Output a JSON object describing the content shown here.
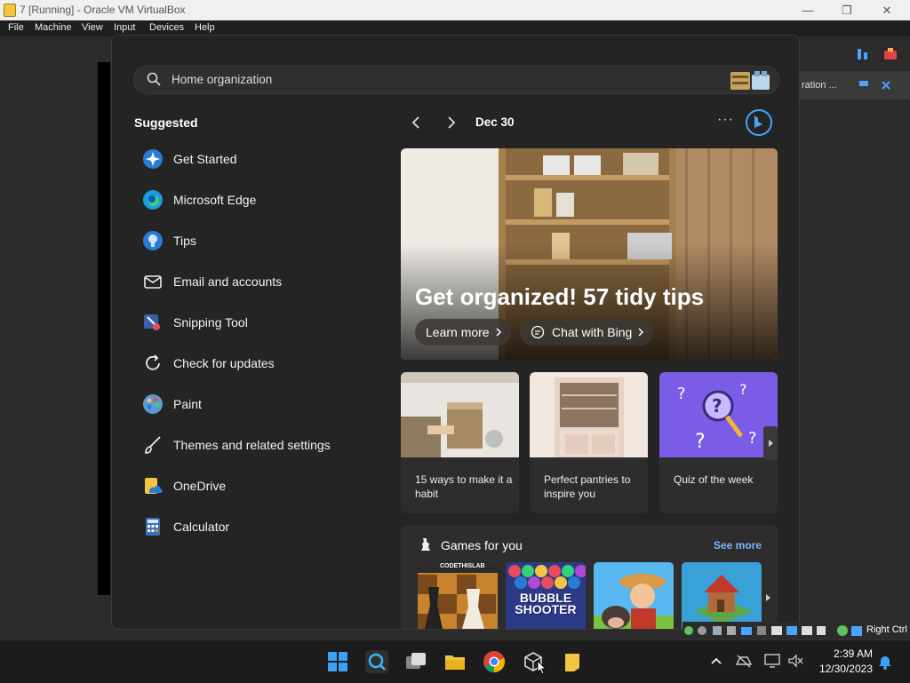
{
  "window": {
    "title": "7 [Running] - Oracle VM VirtualBox",
    "minimize": "—",
    "maximize": "❐",
    "close": "✕"
  },
  "menubar": {
    "items": [
      "File",
      "Machine",
      "View",
      "Input",
      "Devices",
      "Help"
    ]
  },
  "background_window": {
    "partial_text": "ration ..."
  },
  "start_menu": {
    "search": {
      "value": "Home organization"
    },
    "suggested": {
      "heading": "Suggested",
      "items": [
        {
          "label": "Get Started",
          "icon": "get-started-icon"
        },
        {
          "label": "Microsoft Edge",
          "icon": "edge-icon"
        },
        {
          "label": "Tips",
          "icon": "tips-bulb-icon"
        },
        {
          "label": "Email and accounts",
          "icon": "mail-icon"
        },
        {
          "label": "Snipping Tool",
          "icon": "snipping-tool-icon"
        },
        {
          "label": "Check for updates",
          "icon": "refresh-icon"
        },
        {
          "label": "Paint",
          "icon": "paint-palette-icon"
        },
        {
          "label": "Themes and related settings",
          "icon": "brush-icon"
        },
        {
          "label": "OneDrive",
          "icon": "onedrive-icon"
        },
        {
          "label": "Calculator",
          "icon": "calculator-icon"
        }
      ]
    },
    "feed": {
      "date": "Dec 30",
      "more": "···",
      "hero": {
        "title": "Get organized! 57 tidy tips",
        "learn_more": "Learn more",
        "chat_with_bing": "Chat with Bing"
      },
      "cards": [
        {
          "label": "15 ways to make it a habit"
        },
        {
          "label": "Perfect pantries to inspire you"
        },
        {
          "label": "Quiz of the week"
        }
      ],
      "games": {
        "heading": "Games for you",
        "see_more": "See more",
        "tiles": [
          {
            "name": "CodeThisLab chess",
            "text": "CODETHISLAB"
          },
          {
            "name": "Bubble Shooter HD",
            "text": "BUBBLE SHOOTER"
          },
          {
            "name": "Farm game",
            "text": ""
          },
          {
            "name": "Builder game",
            "text": ""
          }
        ]
      }
    }
  },
  "taskbar": {
    "clock_time": "2:39 AM",
    "clock_date": "12/30/2023",
    "right_ctrl": "Right Ctrl"
  },
  "colors": {
    "accent": "#0078d4",
    "link": "#7cb8ff",
    "menu_bg": "#242424"
  }
}
